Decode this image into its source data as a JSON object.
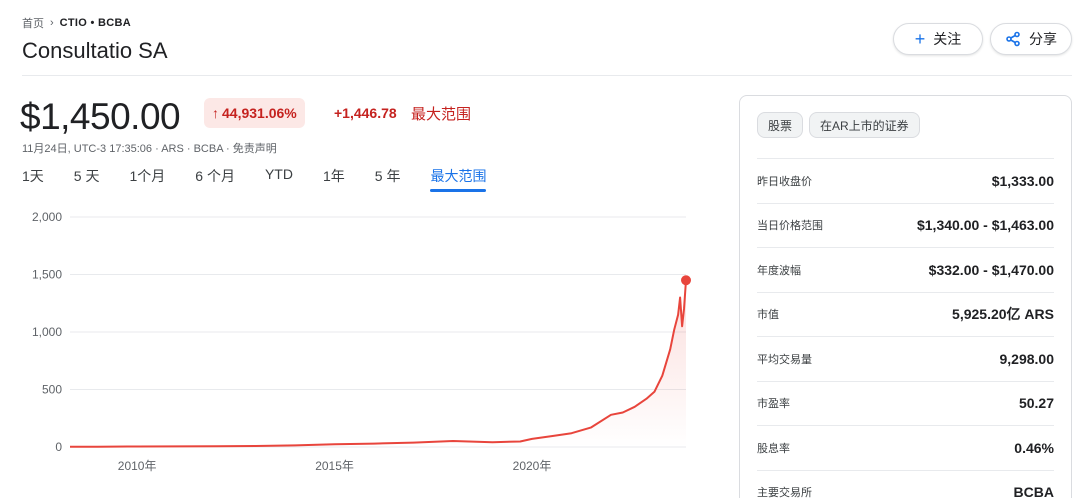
{
  "breadcrumb": {
    "home": "首页",
    "ticker": "CTIO • BCBA"
  },
  "title": "Consultatio SA",
  "actions": {
    "follow_label": "关注",
    "share_label": "分享"
  },
  "quote": {
    "price": "$1,450.00",
    "change_pct": "44,931.06%",
    "change_abs": "+1,446.78",
    "change_period": "最大范围",
    "meta": "11月24日, UTC-3 17:35:06 · ARS · BCBA · ",
    "disclaimer": "免责声明"
  },
  "range_tabs": [
    {
      "label": "1天"
    },
    {
      "label": "5 天"
    },
    {
      "label": "1个月"
    },
    {
      "label": "6 个月"
    },
    {
      "label": "YTD"
    },
    {
      "label": "1年"
    },
    {
      "label": "5 年"
    },
    {
      "label": "最大范围",
      "active": true
    }
  ],
  "colors": {
    "accent": "#1a73e8",
    "negative": "#c5221f",
    "line": "#e8453c"
  },
  "chart_data": {
    "type": "area",
    "y_ticks": [
      "2,000",
      "1,500",
      "1,000",
      "500",
      "0"
    ],
    "x_ticks": [
      "2010年",
      "2015年",
      "2020年"
    ],
    "ylim": [
      0,
      2000
    ],
    "xlim": [
      2008.3,
      2023.9
    ],
    "x": [
      2008.3,
      2009,
      2010,
      2011,
      2012,
      2013,
      2014,
      2015,
      2016,
      2017,
      2018,
      2019,
      2019.7,
      2020,
      2020.5,
      2021,
      2021.5,
      2022,
      2022.3,
      2022.6,
      2022.9,
      2023.1,
      2023.3,
      2023.5,
      2023.6,
      2023.7,
      2023.75,
      2023.8,
      2023.85,
      2023.9
    ],
    "values": [
      3,
      3,
      4,
      5,
      6,
      9,
      14,
      24,
      30,
      38,
      52,
      42,
      48,
      70,
      95,
      120,
      170,
      280,
      300,
      350,
      420,
      480,
      620,
      850,
      1020,
      1150,
      1300,
      1050,
      1200,
      1450
    ],
    "last_value": 1450,
    "grid": true
  },
  "stats": {
    "tags": [
      "股票",
      "在AR上市的证券"
    ],
    "rows": [
      {
        "label": "昨日收盘价",
        "value": "$1,333.00"
      },
      {
        "label": "当日价格范围",
        "value": "$1,340.00 - $1,463.00"
      },
      {
        "label": "年度波幅",
        "value": "$332.00 - $1,470.00"
      },
      {
        "label": "市值",
        "value": "5,925.20亿 ARS"
      },
      {
        "label": "平均交易量",
        "value": "9,298.00"
      },
      {
        "label": "市盈率",
        "value": "50.27"
      },
      {
        "label": "股息率",
        "value": "0.46%"
      },
      {
        "label": "主要交易所",
        "value": "BCBA"
      }
    ]
  }
}
